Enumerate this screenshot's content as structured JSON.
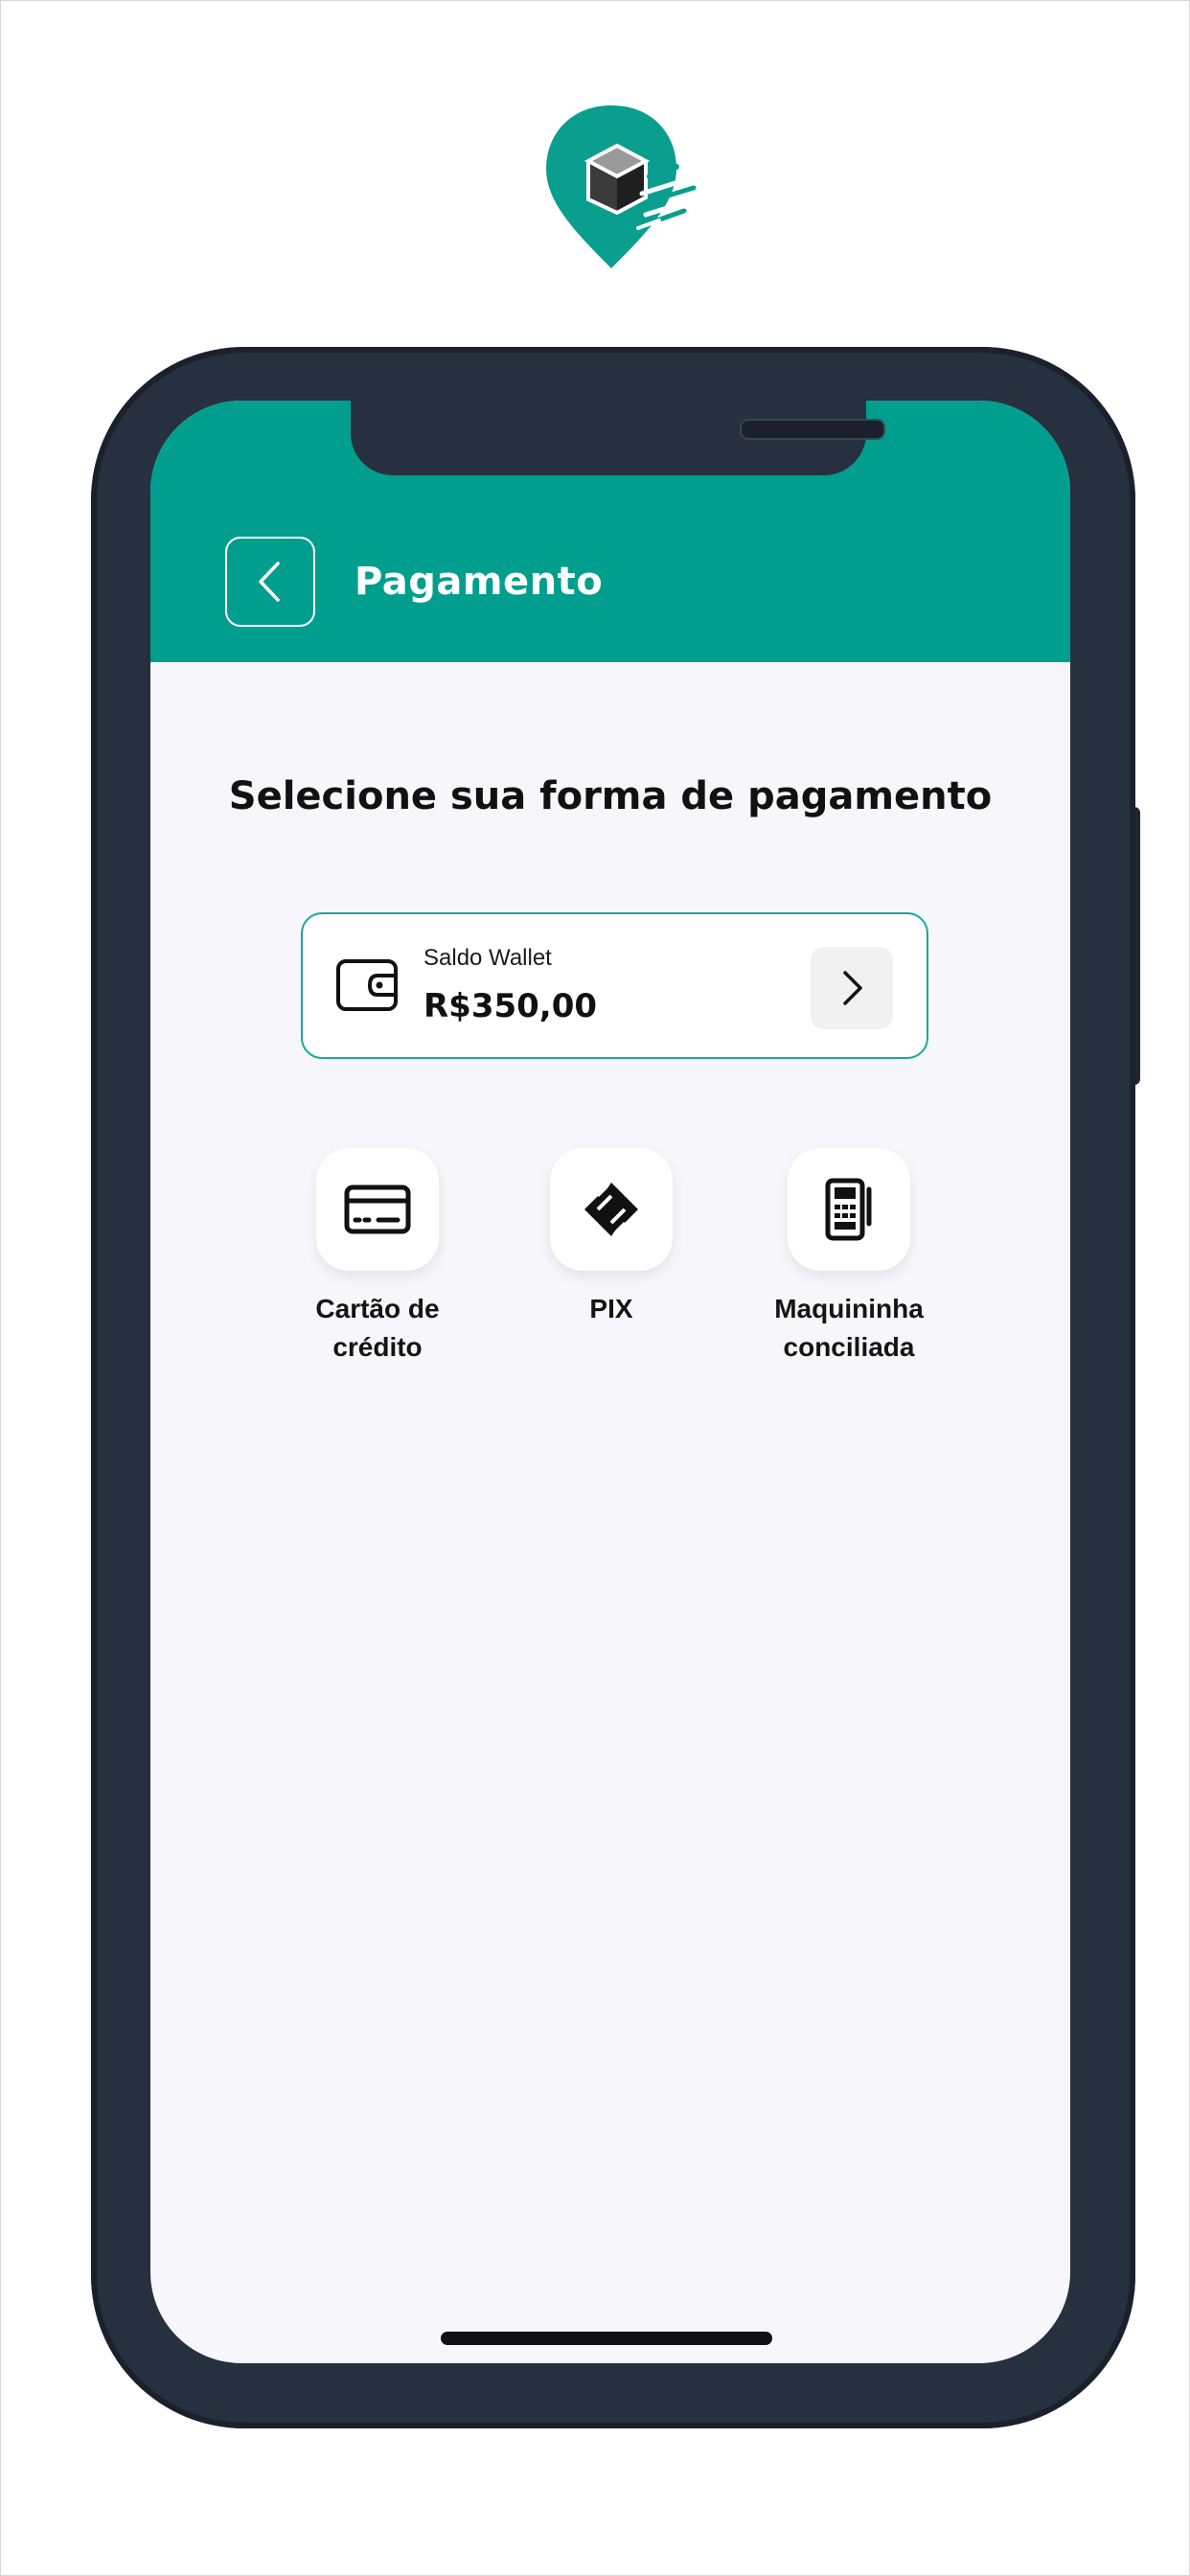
{
  "header": {
    "title": "Pagamento"
  },
  "main": {
    "section_title": "Selecione sua forma de pagamento",
    "wallet": {
      "label": "Saldo Wallet",
      "value": "R$350,00"
    },
    "methods": [
      {
        "label": "Cartão de\ncrédito",
        "icon": "credit-card-icon"
      },
      {
        "label": "PIX",
        "icon": "pix-icon"
      },
      {
        "label": "Maquininha\nconciliada",
        "icon": "card-machine-icon"
      }
    ]
  },
  "colors": {
    "brand": "#009e8e",
    "card_border": "#1aa898",
    "frame": "#26303e",
    "screen_bg": "#f7f6fa"
  }
}
